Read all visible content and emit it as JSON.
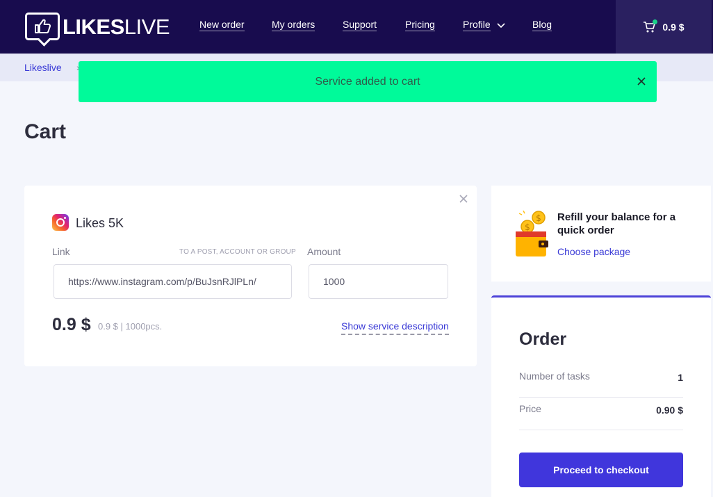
{
  "header": {
    "logo": {
      "bold": "LIKES",
      "light": "LIVE"
    },
    "nav": [
      {
        "label": "New order"
      },
      {
        "label": "My orders"
      },
      {
        "label": "Support"
      },
      {
        "label": "Pricing"
      },
      {
        "label": "Profile"
      },
      {
        "label": "Blog"
      }
    ],
    "cart": {
      "total": "0.9 $",
      "icon": "cart-icon",
      "has_items": true
    }
  },
  "breadcrumb": {
    "home": "Likeslive",
    "separator": "›"
  },
  "toast": {
    "message": "Service added to cart",
    "color": "#00fa9a"
  },
  "page": {
    "title": "Cart"
  },
  "cart_item": {
    "platform_icon": "instagram-icon",
    "service_name": "Likes 5K",
    "link_label": "Link",
    "link_hint": "TO A POST, ACCOUNT OR GROUP",
    "link_value": "https://www.instagram.com/p/BuJsnRJlPLn/",
    "amount_label": "Amount",
    "amount_value": "1000",
    "price": "0.9 $",
    "price_detail": "0.9 $ | 1000pcs.",
    "description_link": "Show service description"
  },
  "refill": {
    "icon": "wallet-coins-icon",
    "title": "Refill your balance for a quick order",
    "link": "Choose package"
  },
  "order": {
    "title": "Order",
    "rows": [
      {
        "label": "Number of tasks",
        "value": "1"
      },
      {
        "label": "Price",
        "value": "0.90 $"
      }
    ],
    "checkout_label": "Proceed to checkout",
    "accent_color": "#4036dc"
  }
}
